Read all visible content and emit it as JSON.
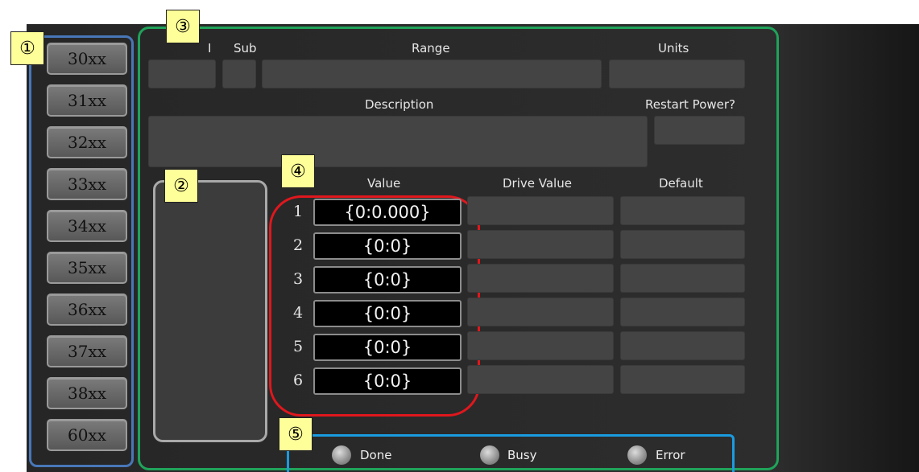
{
  "sidebar": {
    "items": [
      {
        "label": "30xx"
      },
      {
        "label": "31xx"
      },
      {
        "label": "32xx"
      },
      {
        "label": "33xx"
      },
      {
        "label": "34xx"
      },
      {
        "label": "35xx"
      },
      {
        "label": "36xx"
      },
      {
        "label": "37xx"
      },
      {
        "label": "38xx"
      },
      {
        "label": "60xx"
      }
    ]
  },
  "callouts": {
    "one": "①",
    "two": "②",
    "three": "③",
    "four": "④",
    "five": "⑤"
  },
  "header": {
    "index_label": "I",
    "sub_label": "Sub",
    "range_label": "Range",
    "units_label": "Units",
    "description_label": "Description",
    "restart_label": "Restart Power?"
  },
  "table": {
    "columns": {
      "value": "Value",
      "drive_value": "Drive Value",
      "default": "Default"
    },
    "rows": [
      {
        "num": "1",
        "value": "{0:0.000}"
      },
      {
        "num": "2",
        "value": "{0:0}"
      },
      {
        "num": "3",
        "value": "{0:0}"
      },
      {
        "num": "4",
        "value": "{0:0}"
      },
      {
        "num": "5",
        "value": "{0:0}"
      },
      {
        "num": "6",
        "value": "{0:0}"
      }
    ]
  },
  "status": {
    "done": {
      "label": "Done",
      "icon": "status-led-icon"
    },
    "busy": {
      "label": "Busy",
      "icon": "status-led-icon"
    },
    "error": {
      "label": "Error",
      "icon": "status-led-icon"
    }
  },
  "colors": {
    "sidebar_frame": "#4877b8",
    "main_frame": "#1fa35a",
    "value_frame": "#e0171d",
    "status_frame": "#1a9be0",
    "callout_fill": "#ffff99"
  }
}
